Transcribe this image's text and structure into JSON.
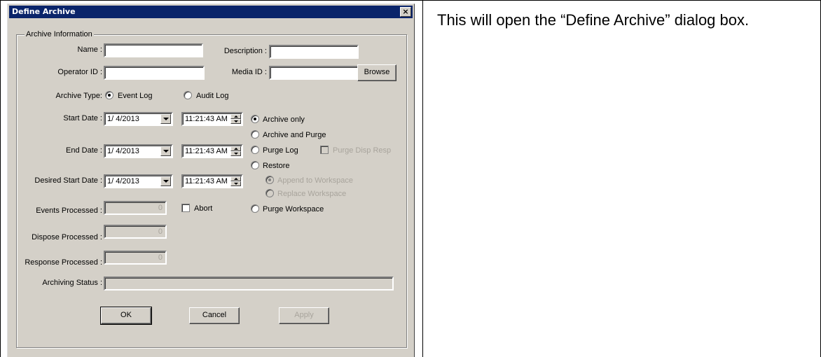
{
  "dialog": {
    "title": "Define Archive",
    "close_glyph": "×",
    "group_caption": "Archive Information",
    "name_label": "Name :",
    "name_value": "",
    "description_label": "Description :",
    "description_value": "",
    "operator_label": "Operator ID :",
    "operator_value": "",
    "media_label": "Media ID :",
    "media_value": "",
    "browse_label": "Browse",
    "archive_type_label": "Archive Type:",
    "event_log_label": "Event Log",
    "audit_log_label": "Audit Log",
    "archive_type_selected": "Event Log",
    "start_date_label": "Start Date :",
    "start_date": "1/ 4/2013",
    "start_time": "11:21:43 AM",
    "end_date_label": "End Date :",
    "end_date": "1/ 4/2013",
    "end_time": "11:21:43 AM",
    "desired_start_label": "Desired Start Date :",
    "desired_start_date": "1/ 4/2013",
    "desired_start_time": "11:21:43 AM",
    "options": {
      "archive_only": "Archive only",
      "archive_and_purge": "Archive and Purge",
      "purge_log": "Purge Log",
      "purge_disp_resp": "Purge Disp Resp",
      "restore": "Restore",
      "append_workspace": "Append to Workspace",
      "replace_workspace": "Replace Workspace",
      "purge_workspace": "Purge Workspace",
      "selected": "Archive only"
    },
    "events_processed_label": "Events Processed :",
    "events_processed": "0",
    "abort_label": "Abort",
    "dispose_processed_label": "Dispose Processed :",
    "dispose_processed": "0",
    "response_processed_label": "Response Processed :",
    "response_processed": "0",
    "archiving_status_label": "Archiving Status :",
    "archiving_status": "",
    "ok_label": "OK",
    "cancel_label": "Cancel",
    "apply_label": "Apply"
  },
  "instruction": {
    "text": "This will open the “Define Archive” dialog box."
  }
}
